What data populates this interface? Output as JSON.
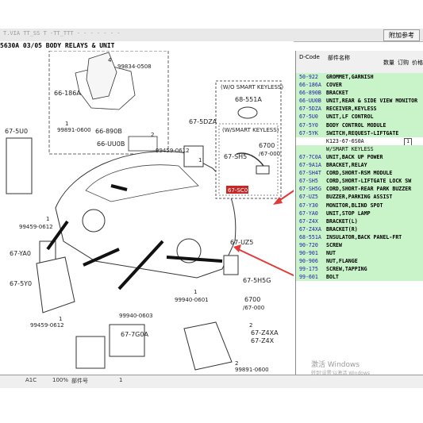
{
  "toolbar": {
    "faint_text": "T.VIA  TT_SS  T -TT_TTT   - - - - - - -",
    "button_label": "附加参考"
  },
  "diagram": {
    "title": "5630A 03/05 BODY RELAYS & UNIT",
    "labels": {
      "l_99834": "99834-0508",
      "l_66186a": "66-186A",
      "l_66890b": "66-890B",
      "l_66uu0b": "66-UU0B",
      "l_99891a": "99891-0600",
      "l_675u0": "67-5U0",
      "l_675dza": "67-5DZA",
      "l_99459a": "99459-0612",
      "l_99459b": "99459-0612",
      "l_99459c": "99459-0612",
      "l_67ya0": "67-YA0",
      "l_675y0": "67-5Y0",
      "l_99940a": "99940-0603",
      "l_99940b": "99940-0601",
      "l_677g0a": "67-7G0A",
      "l_67uz5": "67-UZ5",
      "l_675h5g": "67-5H5G",
      "l_6700": "6700",
      "l_67000": "/67-000",
      "l_67z4xa": "67-Z4XA",
      "l_67z4x": "67-Z4X",
      "l_99891b": "99891-0600",
      "box1_title": "(W/O SMART KEYLESS)",
      "box1_part": "68-551A",
      "box2_title": "(W/SMART KEYLESS)",
      "box2_part1": "6700",
      "box2_part2": "/67-000",
      "box2_part3": "67-SH5",
      "box2_code": "67-SC0"
    },
    "callouts": [
      "4",
      "2",
      "1",
      "1",
      "1",
      "1",
      "1",
      "2",
      "2"
    ]
  },
  "panel": {
    "headers": {
      "dcode": "D-Code",
      "partname": "部件名称",
      "qty": "数量",
      "order": "订购",
      "price": "价格"
    },
    "rows": [
      {
        "code": "50-922",
        "desc": "GROMMET,GARNISH"
      },
      {
        "code": "66-186A",
        "desc": "COVER"
      },
      {
        "code": "66-890B",
        "desc": "BRACKET"
      },
      {
        "code": "66-UU0B",
        "desc": "UNIT,REAR & SIDE VIEW MONITOR"
      },
      {
        "code": "67-5DZA",
        "desc": "RECEIVER,KEYLESS"
      },
      {
        "code": "67-5U0",
        "desc": "UNIT,LF CONTROL"
      },
      {
        "code": "67-5Y0",
        "desc": "BODY CONTROL MODULE"
      },
      {
        "code": "67-5YK",
        "desc": "SWITCH,REQUEST-LIFTGATE"
      },
      {
        "code": "",
        "desc": "K123-67-6S0A",
        "qty": "1"
      },
      {
        "code": "",
        "desc": "W/SMART KEYLESS"
      },
      {
        "code": "67-7C0A",
        "desc": "UNIT,BACK UP POWER"
      },
      {
        "code": "67-9A1A",
        "desc": "BRACKET,RELAY"
      },
      {
        "code": "67-SH4T",
        "desc": "CORD,SHORT-RSM MODULE"
      },
      {
        "code": "67-SH5",
        "desc": "CORD,SHORT-LIFTGATE LOCK SW"
      },
      {
        "code": "67-SH5G",
        "desc": "CORD,SHORT-REAR PARK BUZZER"
      },
      {
        "code": "67-UZ5",
        "desc": "BUZZER,PARKING ASSIST"
      },
      {
        "code": "67-Y30",
        "desc": "MONITOR,BLIND SPOT"
      },
      {
        "code": "67-YA0",
        "desc": "UNIT,STOP LAMP"
      },
      {
        "code": "67-Z4X",
        "desc": "BRACKET(L)"
      },
      {
        "code": "67-Z4XA",
        "desc": "BRACKET(R)"
      },
      {
        "code": "68-551A",
        "desc": "INSULATOR,BACK PANEL-FRT"
      },
      {
        "code": "90-720",
        "desc": "SCREW"
      },
      {
        "code": "90-901",
        "desc": "NUT"
      },
      {
        "code": "90-906",
        "desc": "NUT,FLANGE"
      },
      {
        "code": "99-175",
        "desc": "SCREW,TAPPING"
      },
      {
        "code": "99-601",
        "desc": "BOLT"
      }
    ]
  },
  "statusbar": {
    "items": [
      "A1C",
      "100%",
      "部件号",
      "1"
    ]
  },
  "watermark": {
    "line1": "激活 Windows",
    "line2": "转到'设置'以激活 Windows"
  },
  "colors": {
    "highlight_row": "#c9f3c9",
    "arrow": "#e23a3a",
    "code_text": "#1a1aa0"
  }
}
